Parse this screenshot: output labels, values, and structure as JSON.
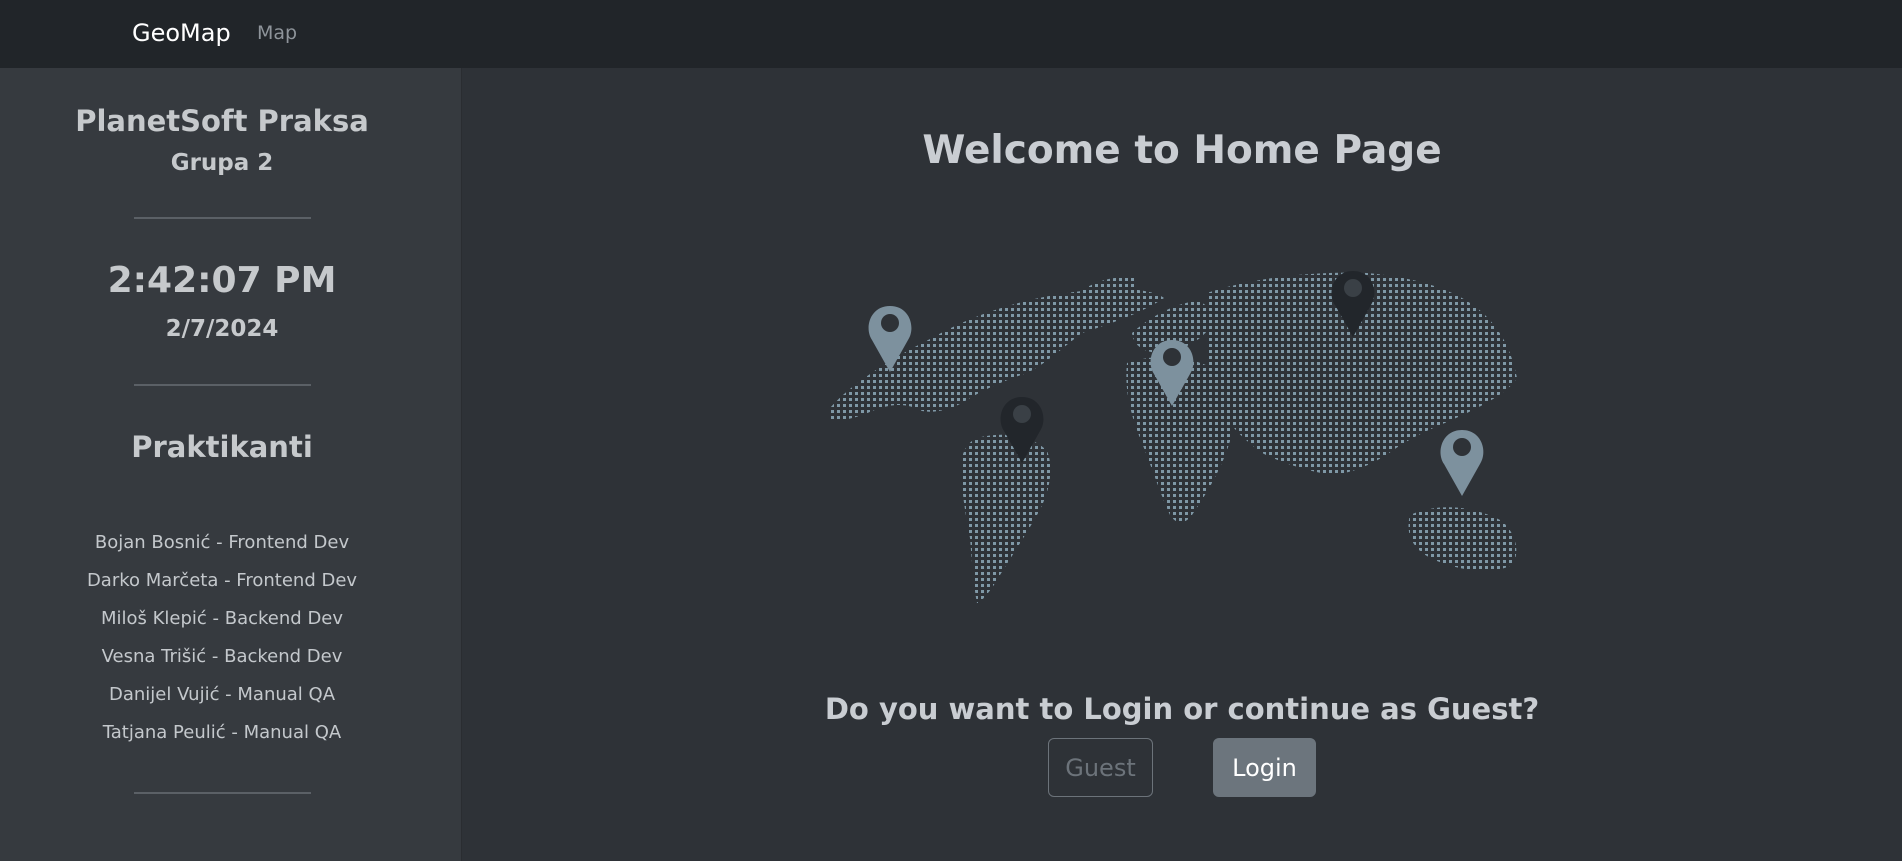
{
  "navbar": {
    "brand": "GeoMap",
    "links": [
      "Map"
    ]
  },
  "sidebar": {
    "title": "PlanetSoft Praksa",
    "subtitle": "Grupa 2",
    "clock": "2:42:07 PM",
    "date": "2/7/2024",
    "section_title": "Praktikanti",
    "members": [
      "Bojan Bosnić - Frontend Dev",
      "Darko Marčeta - Frontend Dev",
      "Miloš Klepić - Backend Dev",
      "Vesna Trišić - Backend Dev",
      "Danijel Vujić - Manual QA",
      "Tatjana Peulić - Manual QA"
    ]
  },
  "main": {
    "heading": "Welcome to Home Page",
    "question": "Do you want to Login or continue as Guest?",
    "guest_label": "Guest",
    "login_label": "Login",
    "illustration": "world-map-with-location-pins"
  },
  "colors": {
    "navbar_bg": "#212529",
    "sidebar_bg": "#363a3f",
    "main_bg": "#2e3237",
    "map_dots": "#7f98a6",
    "pin_light": "#7d919e",
    "pin_dark": "#22262b",
    "login_bg": "#6c757d"
  }
}
